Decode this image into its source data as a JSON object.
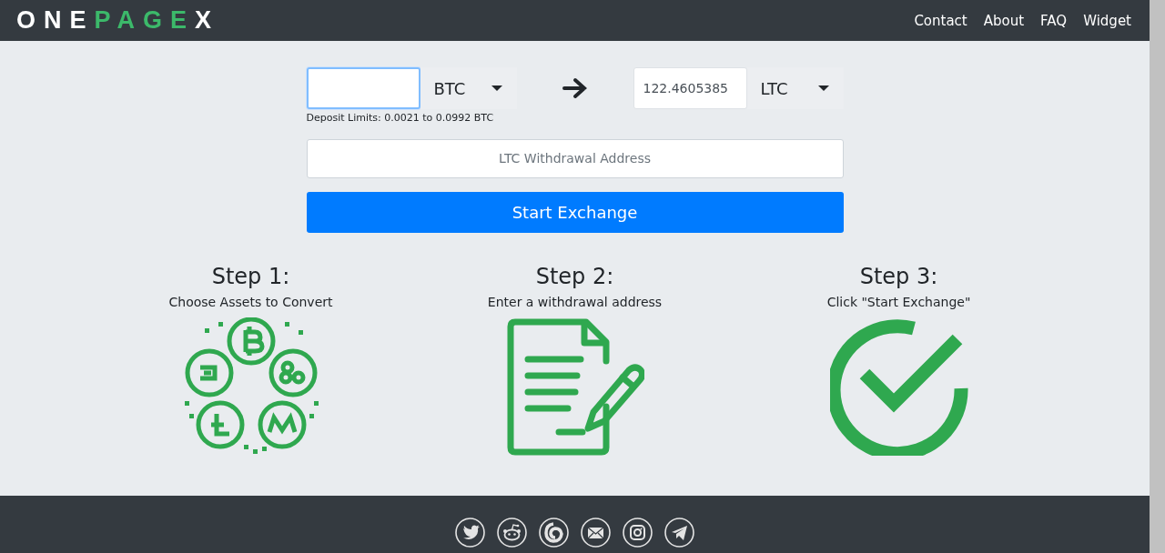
{
  "logo": [
    {
      "text": "ONE",
      "accent": false
    },
    {
      "text": "PAGE",
      "accent": true
    },
    {
      "text": "X",
      "accent": false
    }
  ],
  "nav": [
    {
      "label": "Contact"
    },
    {
      "label": "About"
    },
    {
      "label": "FAQ"
    },
    {
      "label": "Widget"
    }
  ],
  "exchange": {
    "from": {
      "focused": true,
      "currency": "BTC"
    },
    "to": {
      "focused": false,
      "value": "122.4605385",
      "currency": "LTC"
    },
    "deposit_limits": "Deposit Limits: 0.0021 to 0.0992 BTC",
    "address": {
      "placeholder": "LTC Withdrawal Address"
    },
    "submit": "Start Exchange"
  },
  "steps": [
    {
      "title": "Step 1:",
      "text": "Choose Assets to Convert",
      "kind": "coins"
    },
    {
      "title": "Step 2:",
      "text": "Enter a withdrawal address",
      "kind": "document"
    },
    {
      "title": "Step 3:",
      "text": "Click \"Start Exchange\"",
      "kind": "check"
    }
  ],
  "social": [
    {
      "kind": "bird"
    },
    {
      "kind": "alien"
    },
    {
      "kind": "swirl"
    },
    {
      "kind": "mail"
    },
    {
      "kind": "camera"
    },
    {
      "kind": "plane"
    }
  ]
}
